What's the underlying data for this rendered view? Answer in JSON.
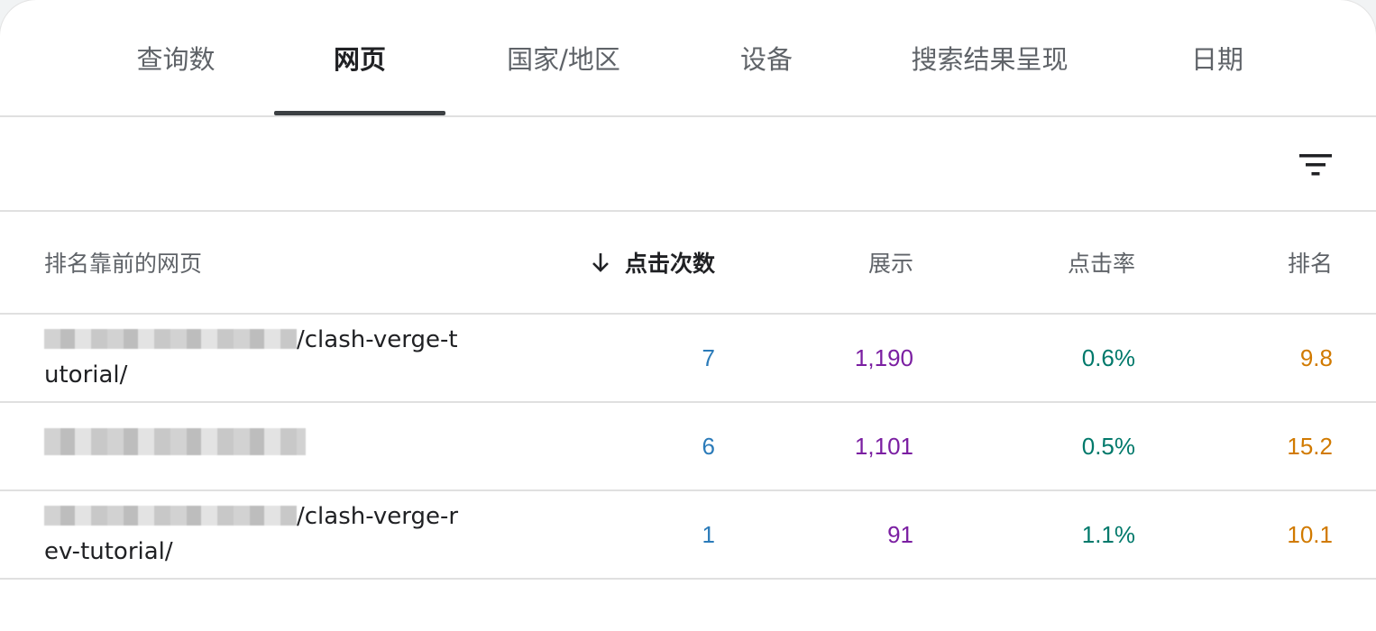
{
  "tabs": [
    {
      "label": "查询数"
    },
    {
      "label": "网页"
    },
    {
      "label": "国家/地区"
    },
    {
      "label": "设备"
    },
    {
      "label": "搜索结果呈现"
    },
    {
      "label": "日期"
    }
  ],
  "active_tab": "网页",
  "toolbar": {
    "filter_icon": "filter-icon"
  },
  "table": {
    "columns": {
      "page": "排名靠前的网页",
      "clicks": "点击次数",
      "impressions": "展示",
      "ctr": "点击率",
      "position": "排名"
    },
    "sort": {
      "column": "clicks",
      "direction": "descending",
      "icon": "arrow-down-icon"
    },
    "rows": [
      {
        "url_suffix": "/clash-verge-tutorial/",
        "clicks": "7",
        "impressions": "1,190",
        "ctr": "0.6%",
        "position": "9.8"
      },
      {
        "url_suffix": "",
        "clicks": "6",
        "impressions": "1,101",
        "ctr": "0.5%",
        "position": "15.2"
      },
      {
        "url_suffix": "/clash-verge-rev-tutorial/",
        "clicks": "1",
        "impressions": "91",
        "ctr": "1.1%",
        "position": "10.1"
      }
    ]
  },
  "colors": {
    "clicks": "#2b7bb9",
    "impressions": "#7b1fa2",
    "ctr": "#00796b",
    "position": "#d17a00"
  }
}
